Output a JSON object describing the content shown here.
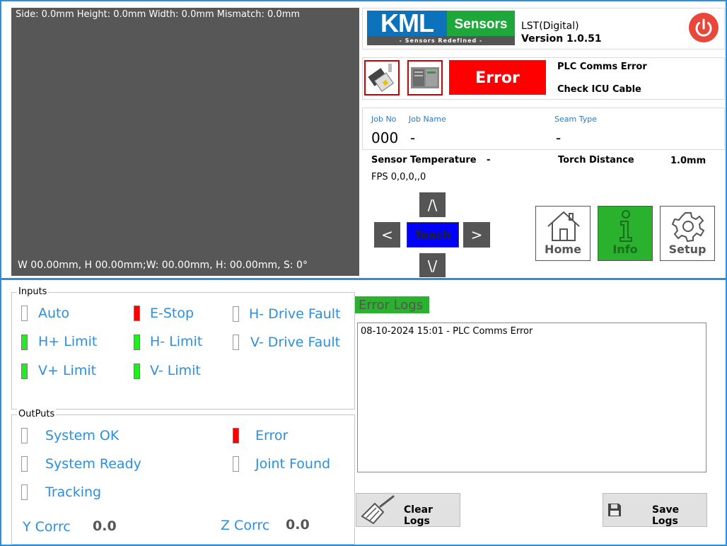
{
  "camera": {
    "top_info": "Side: 0.0mm Height: 0.0mm Width: 0.0mm Mismatch: 0.0mm",
    "bottom_info": "W 00.00mm,  H 00.00mm;W: 00.00mm, H: 00.00mm, S: 0°"
  },
  "header": {
    "logo_kml": "KML",
    "logo_sensors": "Sensors",
    "logo_tagline": "- Sensors Redefined -",
    "app_name": "LST(Digital)",
    "version": "Version 1.0.51",
    "power_icon": "power-icon",
    "power_color": "#e8473b"
  },
  "status": {
    "sensor_icon": "sensor-head-icon",
    "plc_icon": "plc-module-icon",
    "error_label": "Error",
    "error_color": "#ff0000",
    "message_line1": "PLC Comms Error",
    "message_line2": "Check ICU Cable"
  },
  "job": {
    "job_no_label": "Job No",
    "job_name_label": "Job Name",
    "seam_type_label": "Seam Type",
    "job_no": "000",
    "job_name": "-",
    "seam_type": "-",
    "sensor_temp_label": "Sensor Temperature",
    "sensor_temp": "-",
    "torch_distance_label": "Torch Distance",
    "torch_distance": "1.0mm",
    "fps": "FPS 0,0,0,,0"
  },
  "jog": {
    "up": "/\\",
    "down": "\\/",
    "left": "<",
    "right": ">",
    "teach": "Teach",
    "teach_color": "#0000ff"
  },
  "nav": {
    "home": "Home",
    "info": "Info",
    "setup": "Setup",
    "active_color": "#2ab12e"
  },
  "inputs": {
    "title": "Inputs",
    "items": [
      {
        "label": "Auto",
        "state": "off"
      },
      {
        "label": "E-Stop",
        "state": "red"
      },
      {
        "label": "H- Drive Fault",
        "state": "off"
      },
      {
        "label": "H+ Limit",
        "state": "on"
      },
      {
        "label": "H- Limit",
        "state": "on"
      },
      {
        "label": "V- Drive Fault",
        "state": "off"
      },
      {
        "label": "V+ Limit",
        "state": "on"
      },
      {
        "label": "V- Limit",
        "state": "on"
      }
    ]
  },
  "outputs": {
    "title": "OutPuts",
    "items": [
      {
        "label": "System OK",
        "state": "off"
      },
      {
        "label": "Error",
        "state": "red"
      },
      {
        "label": "System Ready",
        "state": "off"
      },
      {
        "label": "Joint Found",
        "state": "off"
      },
      {
        "label": "Tracking",
        "state": "off"
      }
    ],
    "y_corr_label": "Y Corrc",
    "y_corr": "0.0",
    "z_corr_label": "Z Corrc",
    "z_corr": "0.0"
  },
  "logs": {
    "title": "Error Logs",
    "entries": [
      "08-10-2024 15:01 - PLC Comms Error"
    ],
    "clear_label": "Clear Logs",
    "save_label": "Save Logs"
  }
}
